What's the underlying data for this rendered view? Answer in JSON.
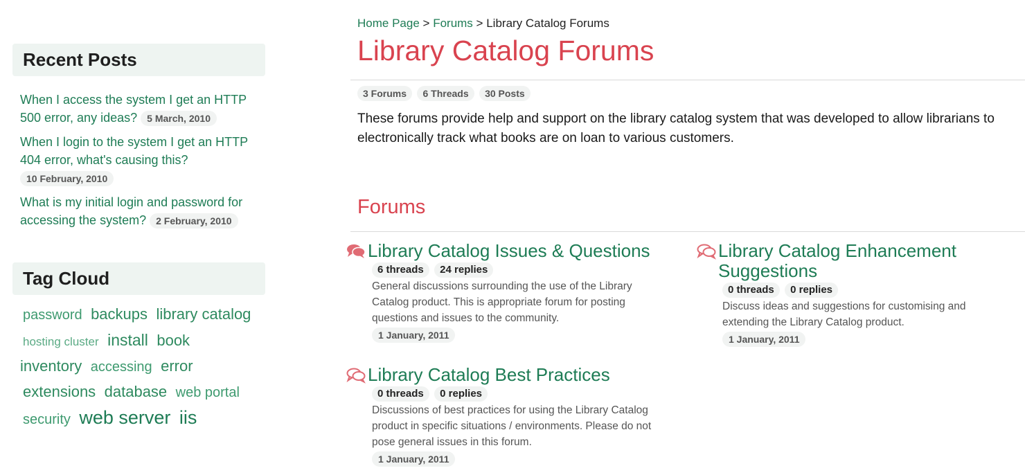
{
  "sidebar": {
    "recent_posts": {
      "title": "Recent Posts",
      "items": [
        {
          "text": "When I access the system I get an HTTP 500 error, any ideas?",
          "date": "5 March, 2010"
        },
        {
          "text": "When I login to the system I get an HTTP 404 error, what's causing this?",
          "date": "10 February, 2010"
        },
        {
          "text": "What is my initial login and password for accessing the system?",
          "date": "2 February, 2010"
        }
      ]
    },
    "tag_cloud": {
      "title": "Tag Cloud",
      "tags": [
        "password",
        "backups",
        "library catalog",
        "hosting cluster",
        "install",
        "book",
        "inventory",
        "accessing",
        "error",
        "extensions",
        "database",
        "web portal",
        "security",
        "web server",
        "iis"
      ]
    }
  },
  "breadcrumb": {
    "home": "Home Page",
    "forums": "Forums",
    "current": "Library Catalog Forums",
    "separator": ">"
  },
  "page_title": "Library Catalog Forums",
  "stats": {
    "forums": "3 Forums",
    "threads": "6 Threads",
    "posts": "30 Posts"
  },
  "description": "These forums provide help and support on the library catalog system that was developed to allow librarians to electronically track what books are on loan to various customers.",
  "section_title": "Forums",
  "forums": [
    {
      "title": "Library Catalog Issues & Questions",
      "threads": "6 threads",
      "replies": "24 replies",
      "description": "General discussions surrounding the use of the Library Catalog product. This is appropriate forum for posting questions and issues to the community.",
      "date": "1 January, 2011",
      "icon": "chat-bubbles-filled-icon"
    },
    {
      "title": "Library Catalog Enhancement Suggestions",
      "threads": "0 threads",
      "replies": "0 replies",
      "description": "Discuss ideas and suggestions for customising and extending the Library Catalog product.",
      "date": "1 January, 2011",
      "icon": "chat-bubbles-outline-icon"
    },
    {
      "title": "Library Catalog Best Practices",
      "threads": "0 threads",
      "replies": "0 replies",
      "description": "Discussions of best practices for using the Library Catalog product in specific situations / environments. Please do not pose general issues in this forum.",
      "date": "1 January, 2011",
      "icon": "chat-bubbles-outline-icon"
    }
  ],
  "colors": {
    "accent": "#d9434f",
    "link": "#1e7c55",
    "panel_bg": "#eef4f1",
    "pill_bg": "#f1f3f2"
  }
}
